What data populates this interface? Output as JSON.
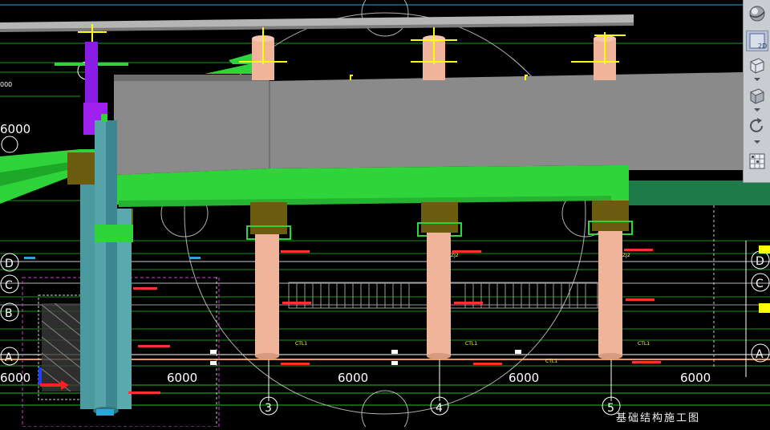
{
  "drawing": {
    "title": "基础结构施工图",
    "grid_rows": [
      "D",
      "C",
      "B",
      "A"
    ],
    "grid_cols": [
      "3",
      "4",
      "5"
    ],
    "dimensions": [
      "6000",
      "6000",
      "6000",
      "6000",
      "6000"
    ],
    "left_edge_dims": [
      "000",
      "6000"
    ],
    "beam_labels": [
      "CTL1",
      "CTL1",
      "CTL1",
      "CTL1",
      "ZJ2",
      "ZJ2"
    ]
  },
  "toolbar": {
    "view_2d_label": "2D"
  },
  "colors": {
    "background": "#000000",
    "slab_green": "#2fd43a",
    "gray_slab": "#8a8a8a",
    "column_salmon": "#f0b49a",
    "pile_cap": "#6b5c10",
    "purple_column": "#8b1ce6",
    "teal_column": "#4a9aa0",
    "grid_green": "#22c022",
    "grid_white": "#ffffff"
  },
  "icons": [
    "orbit-sphere-icon",
    "view-2d-icon",
    "wireframe-cube-icon",
    "solid-cube-icon",
    "rotate-icon",
    "grid-properties-icon"
  ]
}
